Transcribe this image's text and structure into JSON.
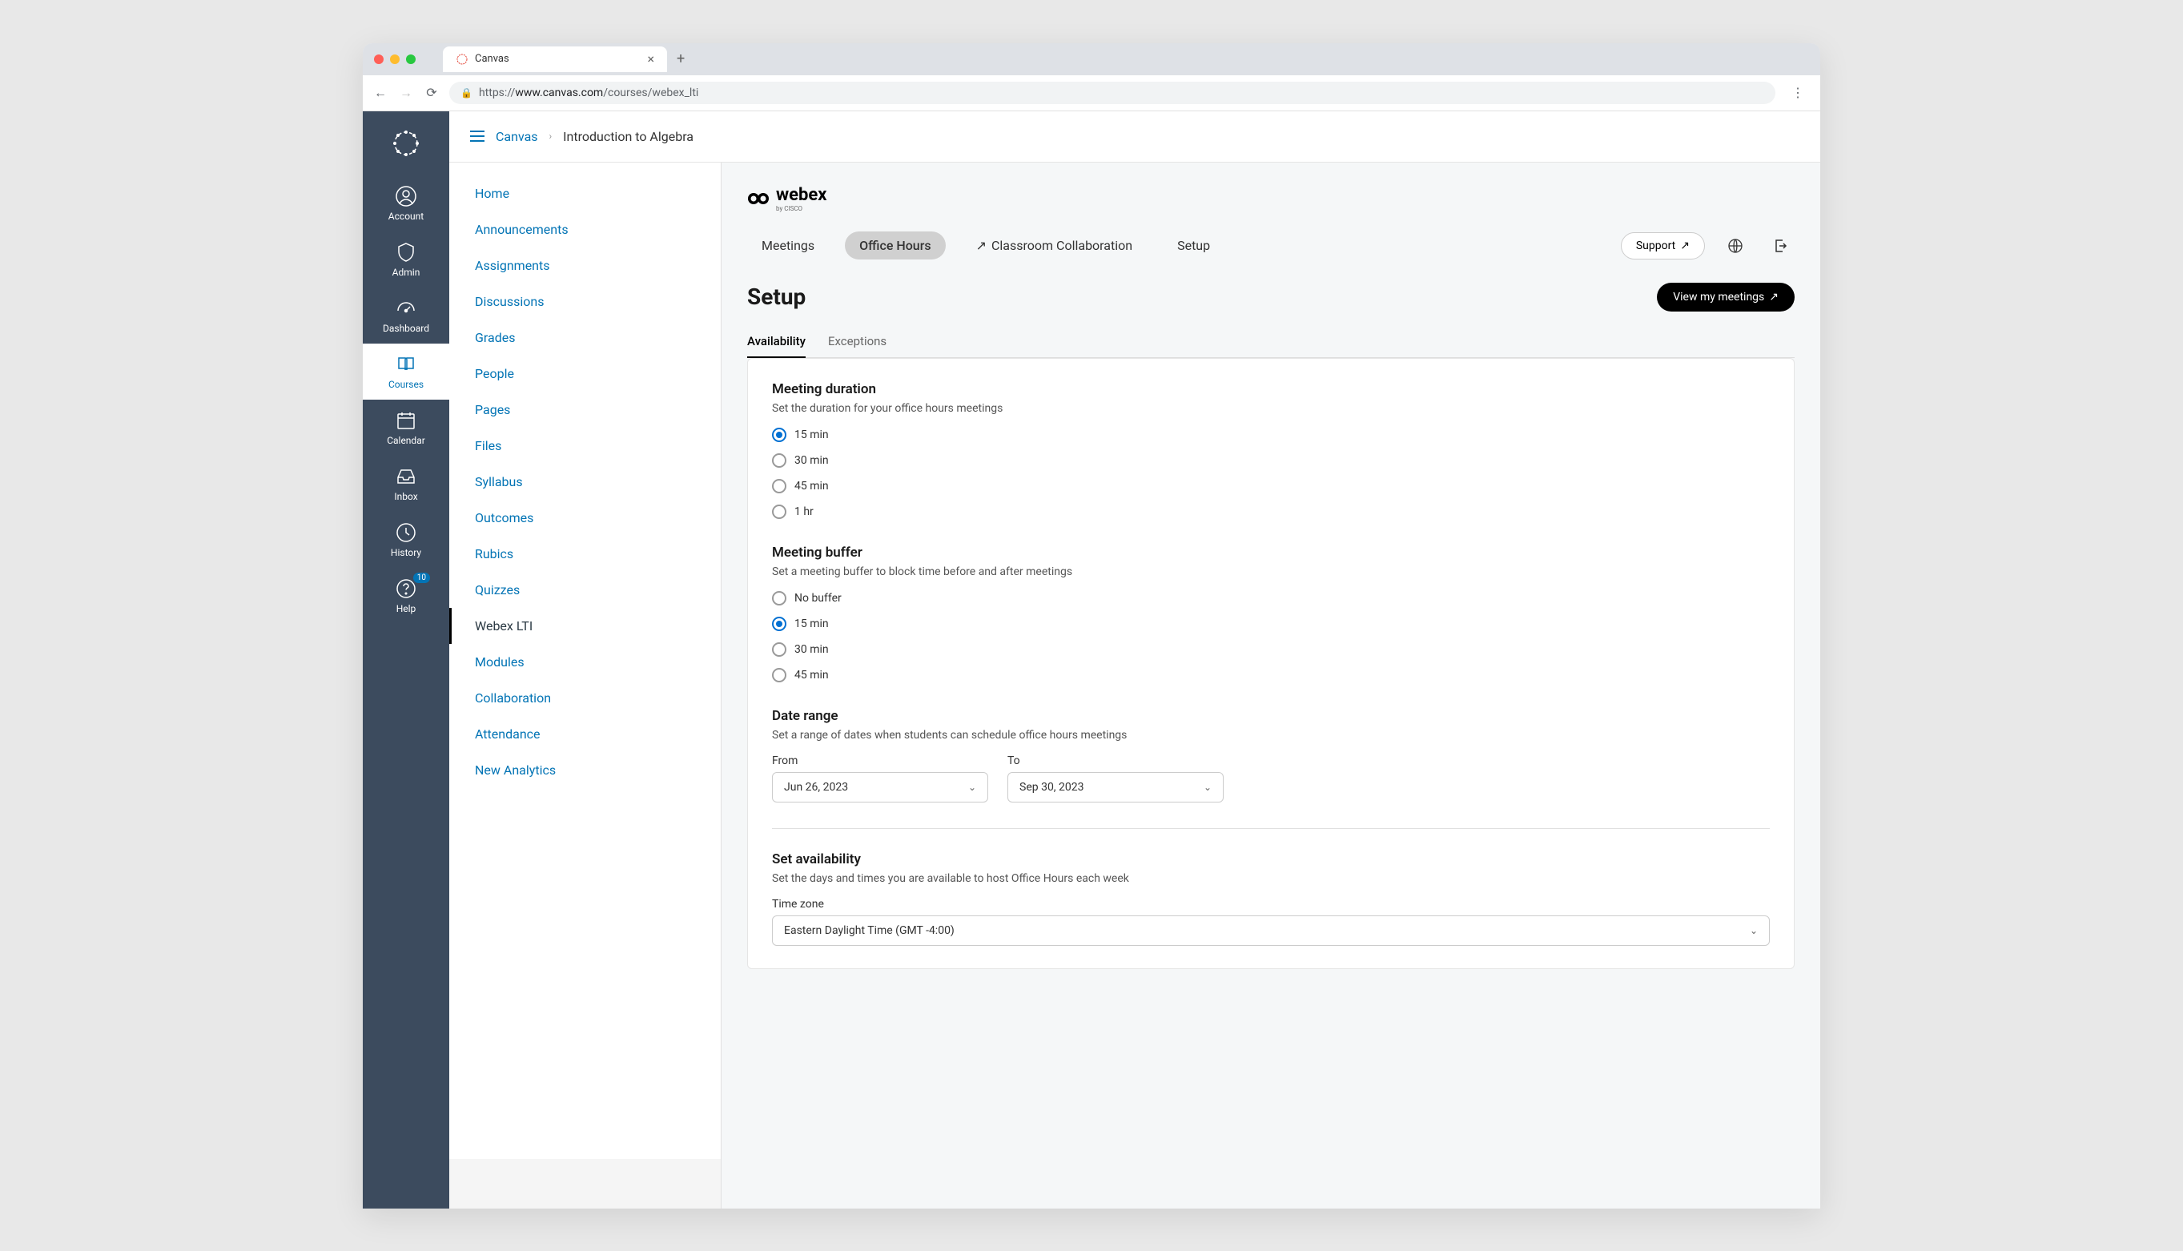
{
  "browser": {
    "tab_title": "Canvas",
    "url_prefix": "https://",
    "url_domain": "www.canvas.com",
    "url_path": "/courses/webex_lti"
  },
  "global_nav": {
    "items": [
      {
        "label": "Account"
      },
      {
        "label": "Admin"
      },
      {
        "label": "Dashboard"
      },
      {
        "label": "Courses"
      },
      {
        "label": "Calendar"
      },
      {
        "label": "Inbox"
      },
      {
        "label": "History"
      },
      {
        "label": "Help",
        "badge": "10"
      }
    ]
  },
  "breadcrumb": {
    "root": "Canvas",
    "current": "Introduction to Algebra"
  },
  "course_nav": {
    "items": [
      "Home",
      "Announcements",
      "Assignments",
      "Discussions",
      "Grades",
      "People",
      "Pages",
      "Files",
      "Syllabus",
      "Outcomes",
      "Rubics",
      "Quizzes",
      "Webex LTI",
      "Modules",
      "Collaboration",
      "Attendance",
      "New Analytics"
    ],
    "active": "Webex LTI"
  },
  "webex": {
    "brand": "webex",
    "by": "by CISCO",
    "nav": {
      "meetings": "Meetings",
      "office_hours": "Office Hours",
      "classroom": "Classroom Collaboration",
      "setup": "Setup",
      "support": "Support"
    },
    "page_title": "Setup",
    "view_meetings": "View my meetings",
    "sub_tabs": {
      "availability": "Availability",
      "exceptions": "Exceptions"
    },
    "meeting_duration": {
      "title": "Meeting duration",
      "desc": "Set the duration for your office hours meetings",
      "options": [
        "15 min",
        "30 min",
        "45 min",
        "1 hr"
      ],
      "selected": "15 min"
    },
    "meeting_buffer": {
      "title": "Meeting buffer",
      "desc": "Set a meeting buffer to block time before and after meetings",
      "options": [
        "No buffer",
        "15 min",
        "30 min",
        "45 min"
      ],
      "selected": "15 min"
    },
    "date_range": {
      "title": "Date range",
      "desc": "Set a range of dates when students can schedule office hours meetings",
      "from_label": "From",
      "to_label": "To",
      "from_value": "Jun 26, 2023",
      "to_value": "Sep 30, 2023"
    },
    "availability": {
      "title": "Set availability",
      "desc": "Set the days and times you are available to host Office Hours each week",
      "tz_label": "Time zone",
      "tz_value": "Eastern Daylight Time (GMT -4:00)"
    }
  }
}
